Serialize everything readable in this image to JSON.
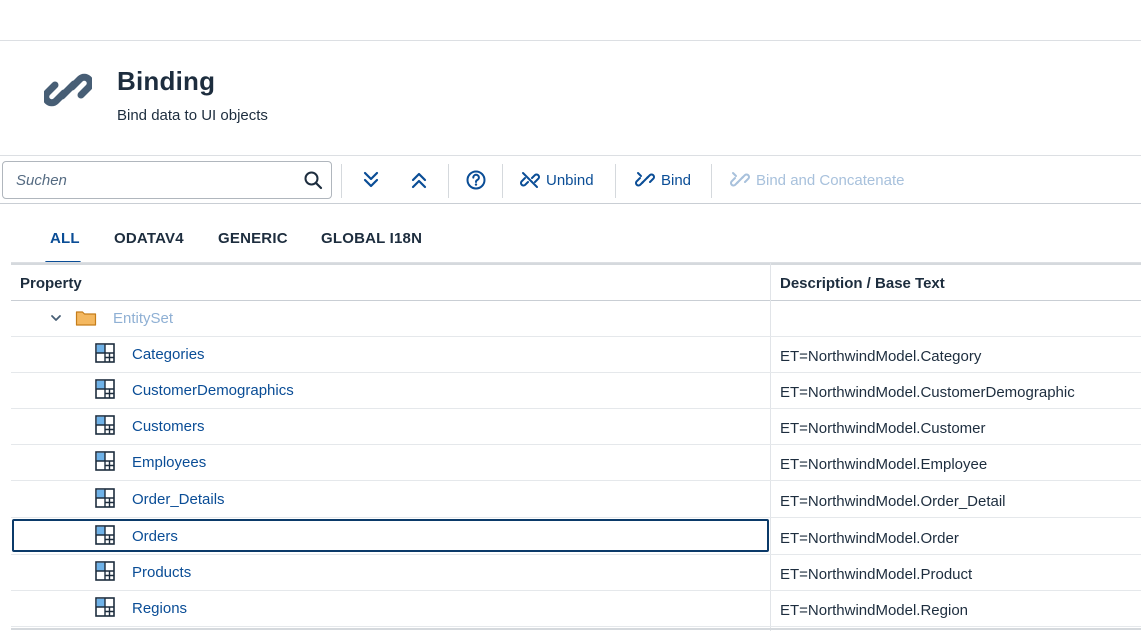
{
  "header": {
    "title": "Binding",
    "subtitle": "Bind data to UI objects",
    "icon": "link-icon"
  },
  "toolbar": {
    "search_placeholder": "Suchen",
    "search_value": "",
    "expand_all_icon": "chevron-double-down-icon",
    "collapse_all_icon": "chevron-double-up-icon",
    "help_icon": "help-icon",
    "unbind_label": "Unbind",
    "bind_label": "Bind",
    "bind_concat_label": "Bind and Concatenate"
  },
  "tabs": [
    {
      "label": "ALL",
      "active": true
    },
    {
      "label": "ODATAV4",
      "active": false
    },
    {
      "label": "GENERIC",
      "active": false
    },
    {
      "label": "GLOBAL I18N",
      "active": false
    }
  ],
  "table": {
    "columns": [
      "Property",
      "Description / Base Text"
    ],
    "group": {
      "label": "EntitySet",
      "expanded": true,
      "icon": "folder-icon"
    },
    "rows": [
      {
        "name": "Categories",
        "desc": "ET=NorthwindModel.Category"
      },
      {
        "name": "CustomerDemographics",
        "desc": "ET=NorthwindModel.CustomerDemographic"
      },
      {
        "name": "Customers",
        "desc": "ET=NorthwindModel.Customer"
      },
      {
        "name": "Employees",
        "desc": "ET=NorthwindModel.Employee"
      },
      {
        "name": "Order_Details",
        "desc": "ET=NorthwindModel.Order_Detail"
      },
      {
        "name": "Orders",
        "desc": "ET=NorthwindModel.Order",
        "selected": true
      },
      {
        "name": "Products",
        "desc": "ET=NorthwindModel.Product"
      },
      {
        "name": "Regions",
        "desc": "ET=NorthwindModel.Region"
      }
    ]
  },
  "colors": {
    "accent": "#0a4d96",
    "text": "#1d2d3e",
    "disabled": "#a8c1dc",
    "folder": "#e9a23b"
  }
}
